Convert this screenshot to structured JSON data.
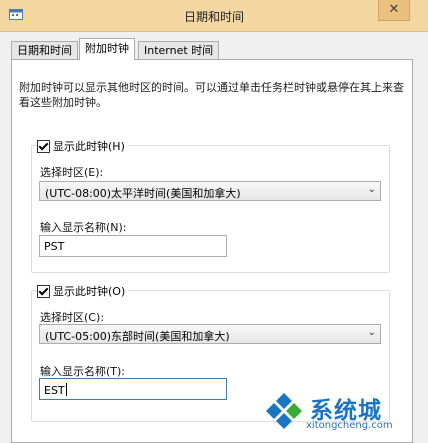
{
  "window": {
    "title": "日期和时间",
    "close_glyph": "✕",
    "icon": "date-time-icon"
  },
  "tabs": [
    {
      "label": "日期和时间",
      "active": false
    },
    {
      "label": "附加时钟",
      "active": true
    },
    {
      "label": "Internet 时间",
      "active": false
    }
  ],
  "panel": {
    "description": "附加时钟可以显示其他时区的时间。可以通过单击任务栏时钟或悬停在其上来查看这些附加时钟。",
    "clocks": [
      {
        "show_clock_label": "显示此时钟(H)",
        "show_clock_checked": true,
        "timezone_label": "选择时区(E):",
        "timezone_value": "(UTC-08:00)太平洋时间(美国和加拿大)",
        "display_name_label": "输入显示名称(N):",
        "display_name_value": "PST"
      },
      {
        "show_clock_label": "显示此时钟(O)",
        "show_clock_checked": true,
        "timezone_label": "选择时区(C):",
        "timezone_value": "(UTC-05:00)东部时间(美国和加拿大)",
        "display_name_label": "输入显示名称(T):",
        "display_name_value": "EST"
      }
    ]
  },
  "watermark": {
    "text": "系统城",
    "url": "xitongcheng.com",
    "colors": {
      "blue": "#1a75c4",
      "green": "#3aa935"
    }
  },
  "colors": {
    "titlebar": "#f4d6a0",
    "panel": "#ffffff",
    "background": "#f0f0f0"
  }
}
